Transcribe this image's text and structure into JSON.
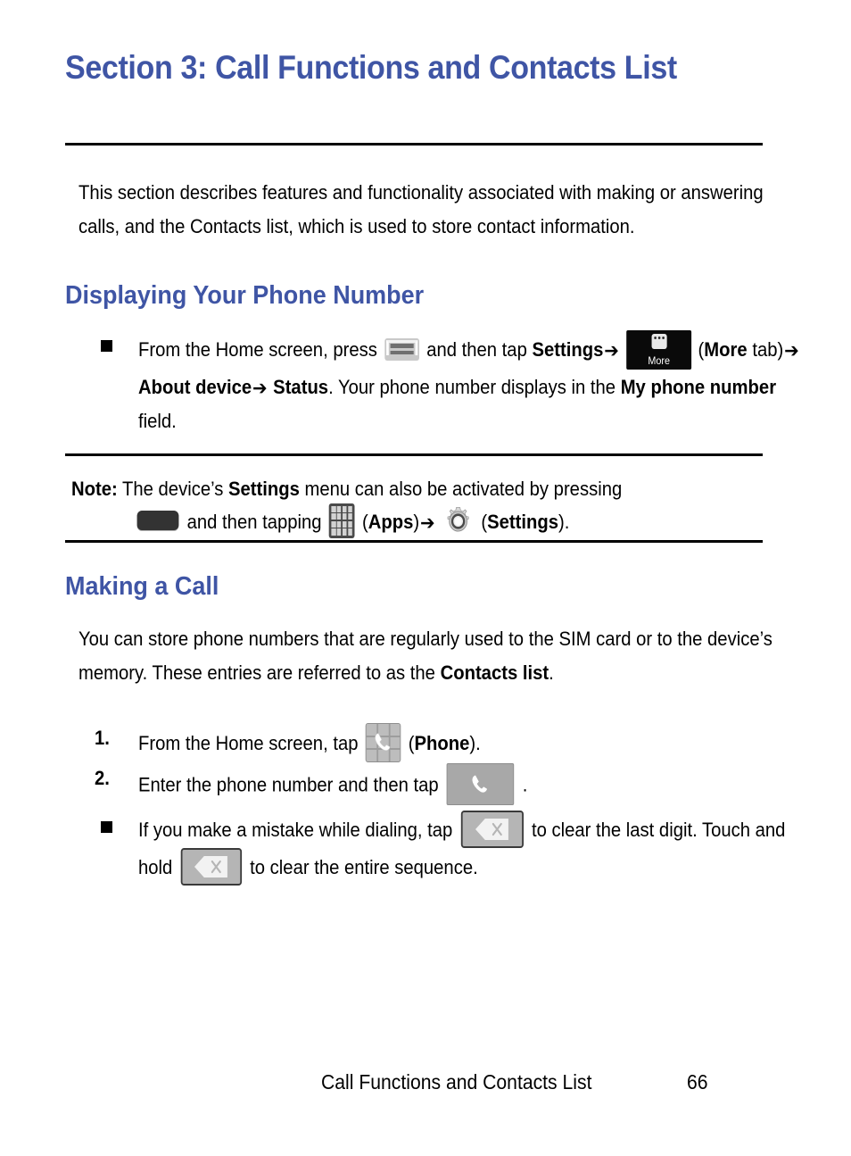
{
  "document": {
    "title": "Section 3: Call Functions and Contacts List",
    "intro": "This section describes features and functionality associated with making or answering calls, and the Contacts list, which is used to store contact information."
  },
  "sections": {
    "displaying_phone_number": {
      "heading": "Displaying Your Phone Number",
      "bullet": {
        "part1": "From the Home screen, press",
        "part2": "and then tap",
        "settings_bold": "Settings",
        "arrow": "➔",
        "more_tab_open": "(",
        "more_bold": "More",
        "more_tab_word": "tab)",
        "more_tab_close": ")",
        "about_device_bold": "About device",
        "status_bold": "Status",
        "part3": ". Your phone number displays in the",
        "my_phone_number_bold": "My phone number",
        "part4": "field."
      }
    },
    "note": {
      "label": "Note:",
      "line1_a": "The device’s",
      "line1_bold": "Settings",
      "line1_b": "menu can also be activated by pressing",
      "line2_a": "and then tapping",
      "apps_open": "(",
      "apps_bold": "Apps",
      "apps_close": ")",
      "arrow": "➔",
      "settings_open": "(",
      "settings_bold": "Settings",
      "settings_close": ")."
    },
    "making_a_call": {
      "heading": "Making a Call",
      "paragraph_a": "You can store phone numbers that are regularly used to the SIM card or to the device’s memory. These entries are referred to as the",
      "paragraph_bold": "Contacts list",
      "paragraph_b": ".",
      "steps": [
        {
          "number": "1.",
          "text_a": "From the Home screen, tap",
          "label_open": "(",
          "label_bold": "Phone",
          "label_close": ")."
        },
        {
          "number": "2.",
          "text_a": "Enter the phone number and then tap",
          "text_b": "."
        }
      ],
      "bullet": {
        "text_a": "If you make a mistake while dialing, tap",
        "text_b": "to clear the last digit. Touch and hold",
        "text_c": "to clear the entire sequence."
      }
    }
  },
  "icons": {
    "menu_key": "menu-key-icon",
    "more_tab": "more-tab-icon",
    "more_tab_label": "More",
    "home_key": "home-key-icon",
    "apps_grid": "apps-grid-icon",
    "settings_gear": "settings-gear-icon",
    "phone_app": "phone-app-icon",
    "call_button": "call-button-icon",
    "backspace": "backspace-icon"
  },
  "footer": {
    "title": "Call Functions and Contacts List",
    "page_number": "66"
  },
  "colors": {
    "heading_blue": "#3f55a5",
    "rule_black": "#000000",
    "page_background": "#ffffff"
  }
}
